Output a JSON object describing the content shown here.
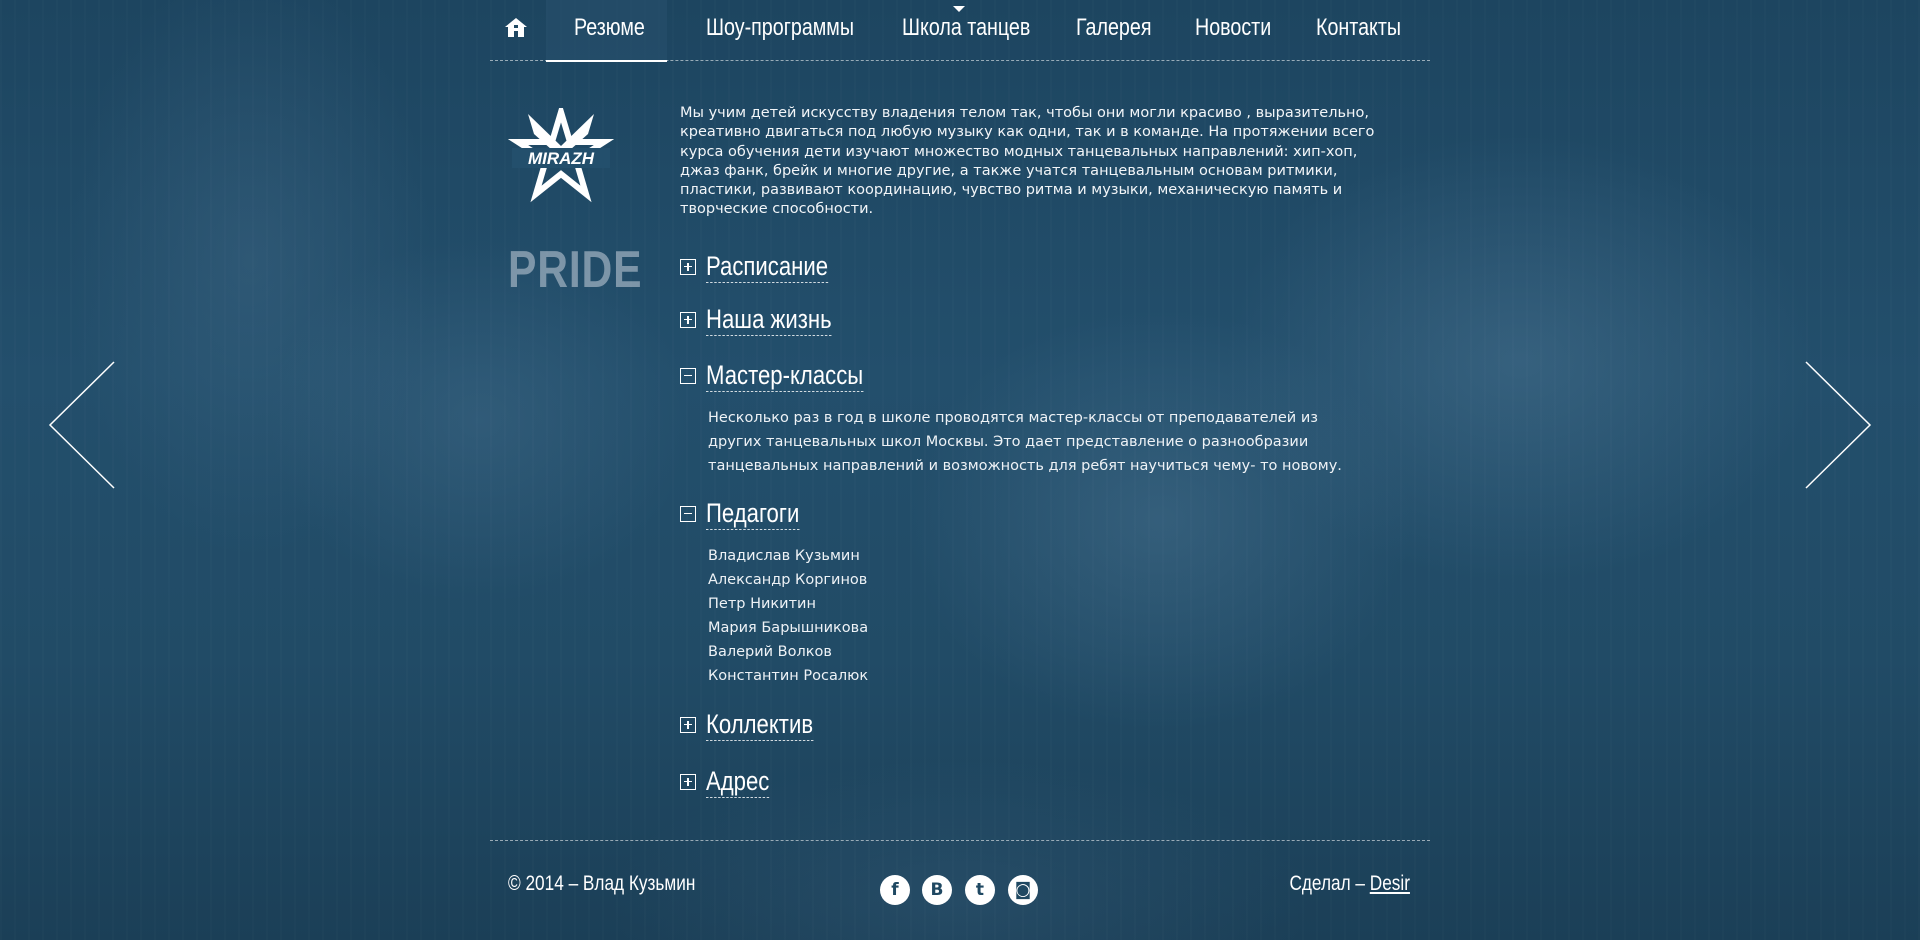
{
  "nav": {
    "items": [
      {
        "label": "Резюме",
        "active": true
      },
      {
        "label": "Шоу-программы"
      },
      {
        "label": "Школа танцев"
      },
      {
        "label": "Галерея"
      },
      {
        "label": "Новости"
      },
      {
        "label": "Контакты"
      }
    ],
    "home_icon": "home-icon",
    "active_caret_icon": "caret-down-icon"
  },
  "brand": {
    "logo_text": "MIRAZH",
    "subtitle": "PRIDE"
  },
  "intro": "Мы учим детей искусству владения телом так, чтобы они могли красиво , выразительно, креативно двигаться под любую музыку как одни, так и в команде. На протяжении всего курса обучения дети изучают множество модных танцевальных направлений: хип-хоп, джаз фанк,  брейк  и многие другие, а также учатся танцевальным основам ритмики, пластики, развивают координацию, чувство ритма и музыки, механическую память и творческие способности.",
  "accordion": [
    {
      "title": "Расписание",
      "expanded": false
    },
    {
      "title": "Наша жизнь",
      "expanded": false
    },
    {
      "title": "Мастер-классы",
      "expanded": true,
      "body": "Несколько раз в год в школе проводятся мастер-классы от преподавателей из других танцевальных школ Москвы. Это дает представление о разнообразии танцевальных направлений и возможность для ребят научиться чему- то новому."
    },
    {
      "title": "Педагоги",
      "expanded": true,
      "teachers": [
        "Владислав Кузьмин",
        "Александр Коргинов",
        "Петр Никитин",
        "Мария Барышникова",
        "Валерий Волков",
        "Константин Росалюк"
      ]
    },
    {
      "title": "Коллектив",
      "expanded": false
    },
    {
      "title": "Адрес",
      "expanded": false
    }
  ],
  "footer": {
    "copyright": "© 2014 – Влад Кузьмин",
    "made_by_prefix": "Сделал – ",
    "made_by_link": "Desir",
    "social": [
      {
        "icon": "facebook-icon",
        "glyph": "f"
      },
      {
        "icon": "vk-icon",
        "glyph": "B"
      },
      {
        "icon": "twitter-icon",
        "glyph": "t"
      },
      {
        "icon": "instagram-icon",
        "glyph": "◙"
      }
    ]
  },
  "colors": {
    "background": "#214b66",
    "text": "#ffffff",
    "logo_muted": "#c8d2dc"
  }
}
